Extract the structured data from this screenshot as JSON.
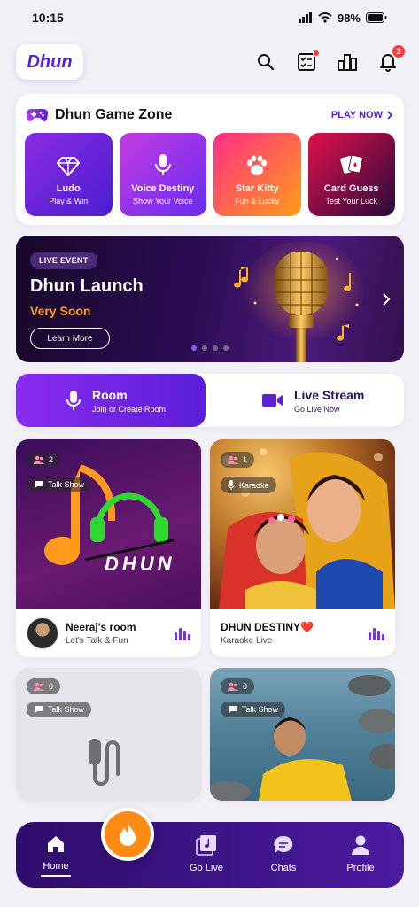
{
  "status": {
    "time": "10:15",
    "battery": "98%"
  },
  "header": {
    "logo": "Dhun",
    "notification_count": "3"
  },
  "game_zone": {
    "title": "Dhun Game Zone",
    "play_now": "PLAY NOW",
    "games": [
      {
        "name": "Ludo",
        "sub": "Play & Win",
        "icon": "diamond-icon",
        "colors": [
          "#8a2be2",
          "#4b1ed0"
        ]
      },
      {
        "name": "Voice Destiny",
        "sub": "Show Your Voice",
        "icon": "microphone-icon",
        "colors": [
          "#c23ce0",
          "#6a2cf0"
        ]
      },
      {
        "name": "Star Kitty",
        "sub": "Fun & Lucky",
        "icon": "paw-icon",
        "colors": [
          "#ff2e86",
          "#ff9c1a"
        ]
      },
      {
        "name": "Card Guess",
        "sub": "Test Your Luck",
        "icon": "cards-icon",
        "colors": [
          "#e0104a",
          "#2a0b3d"
        ]
      }
    ]
  },
  "banner": {
    "tag": "LIVE EVENT",
    "title": "Dhun Launch",
    "subtitle": "Very Soon",
    "cta": "Learn More"
  },
  "modes": {
    "room": {
      "title": "Room",
      "sub": "Join or Create Room"
    },
    "live": {
      "title": "Live Stream",
      "sub": "Go Live Now"
    }
  },
  "rooms": [
    {
      "count": "2",
      "tag": "Talk Show",
      "title": "Neeraj's room",
      "sub": "Let's Talk & Fun",
      "art_text": "DHUN"
    },
    {
      "count": "1",
      "tag": "Karaoke",
      "title": "DHUN DESTINY❤️",
      "sub": "Karaoke Live"
    },
    {
      "count": "0",
      "tag": "Talk Show"
    },
    {
      "count": "0",
      "tag": "Talk Show"
    }
  ],
  "nav": {
    "home": "Home",
    "go_live": "Go Live",
    "chats": "Chats",
    "profile": "Profile"
  }
}
